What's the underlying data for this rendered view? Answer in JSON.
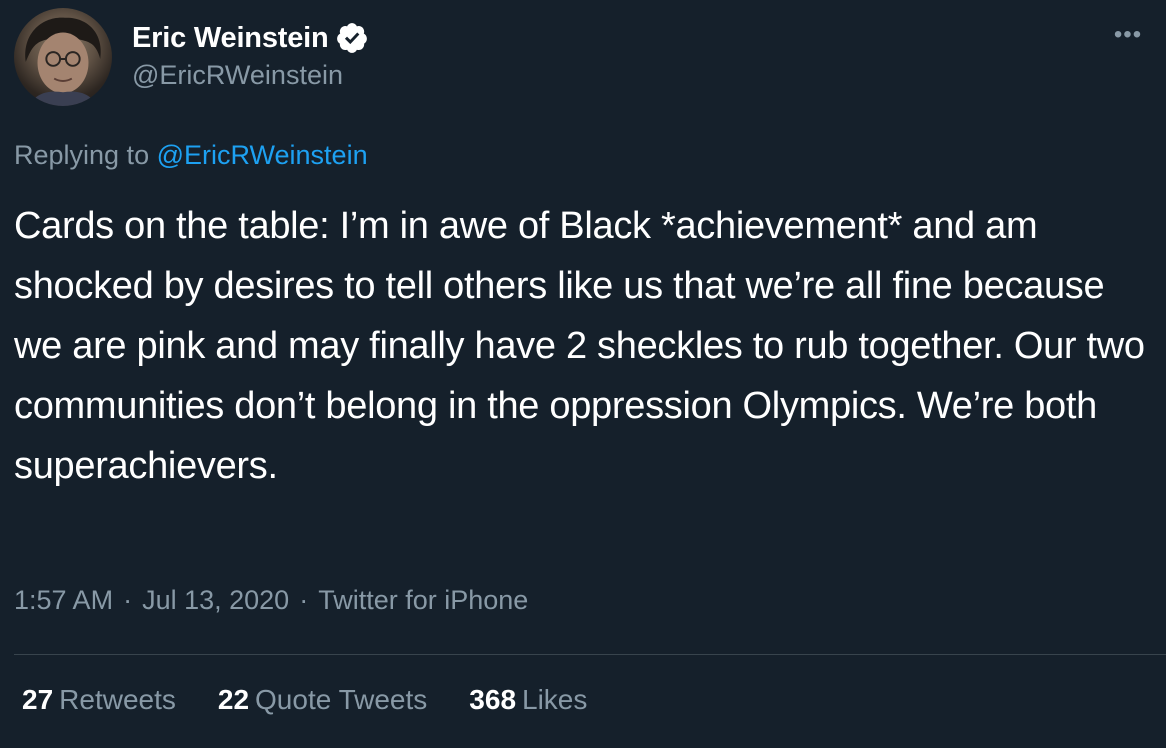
{
  "author": {
    "display_name": "Eric Weinstein",
    "handle": "@EricRWeinstein",
    "verified_icon": "verified-badge-icon",
    "avatar_icon": "avatar"
  },
  "more_icon": "more-dots-icon",
  "reply": {
    "prefix": "Replying to",
    "mention": "@EricRWeinstein"
  },
  "tweet_text": "Cards on the table: I’m in awe of Black *achievement* and am shocked by desires to tell others like us that we’re all fine because we are pink and may finally have 2 sheckles to rub together. Our two communities don’t belong in the oppression Olympics. We’re both superachievers.",
  "meta": {
    "time": "1:57 AM",
    "separator": "·",
    "date": "Jul 13, 2020",
    "source": "Twitter for iPhone"
  },
  "stats": {
    "retweets": {
      "count": "27",
      "label": "Retweets"
    },
    "quotes": {
      "count": "22",
      "label": "Quote Tweets"
    },
    "likes": {
      "count": "368",
      "label": "Likes"
    }
  },
  "colors": {
    "background": "#15202b",
    "secondary_text": "#8899a6",
    "link": "#1da1f2",
    "divider": "#38444d"
  }
}
